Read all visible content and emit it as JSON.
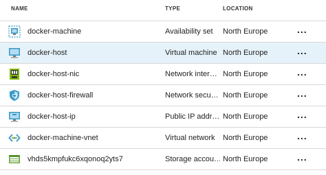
{
  "columns": {
    "name": "NAME",
    "type": "TYPE",
    "location": "LOCATION"
  },
  "rows": [
    {
      "name": "docker-machine",
      "type": "Availability set",
      "location": "North Europe",
      "icon": "availability-set-icon",
      "more": "..."
    },
    {
      "name": "docker-host",
      "type": "Virtual machine",
      "location": "North Europe",
      "icon": "virtual-machine-icon",
      "selected": true,
      "more": "..."
    },
    {
      "name": "docker-host-nic",
      "type": "Network inter…",
      "location": "North Europe",
      "icon": "network-interface-icon",
      "more": "..."
    },
    {
      "name": "docker-host-firewall",
      "type": "Network secu…",
      "location": "North Europe",
      "icon": "network-security-group-icon",
      "more": "..."
    },
    {
      "name": "docker-host-ip",
      "type": "Public IP addr…",
      "location": "North Europe",
      "icon": "public-ip-icon",
      "more": "..."
    },
    {
      "name": "docker-machine-vnet",
      "type": "Virtual network",
      "location": "North Europe",
      "icon": "virtual-network-icon",
      "more": "..."
    },
    {
      "name": "vhds5kmpfukc6xqonoq2yts7",
      "type": "Storage accou…",
      "location": "North Europe",
      "icon": "storage-account-icon",
      "more": "..."
    }
  ],
  "colors": {
    "selected_row": "#e6f2fa",
    "azure_blue": "#3999c6",
    "nic_green": "#7fba00",
    "storage_green": "#68a43a",
    "divider": "#d8d8d8"
  }
}
